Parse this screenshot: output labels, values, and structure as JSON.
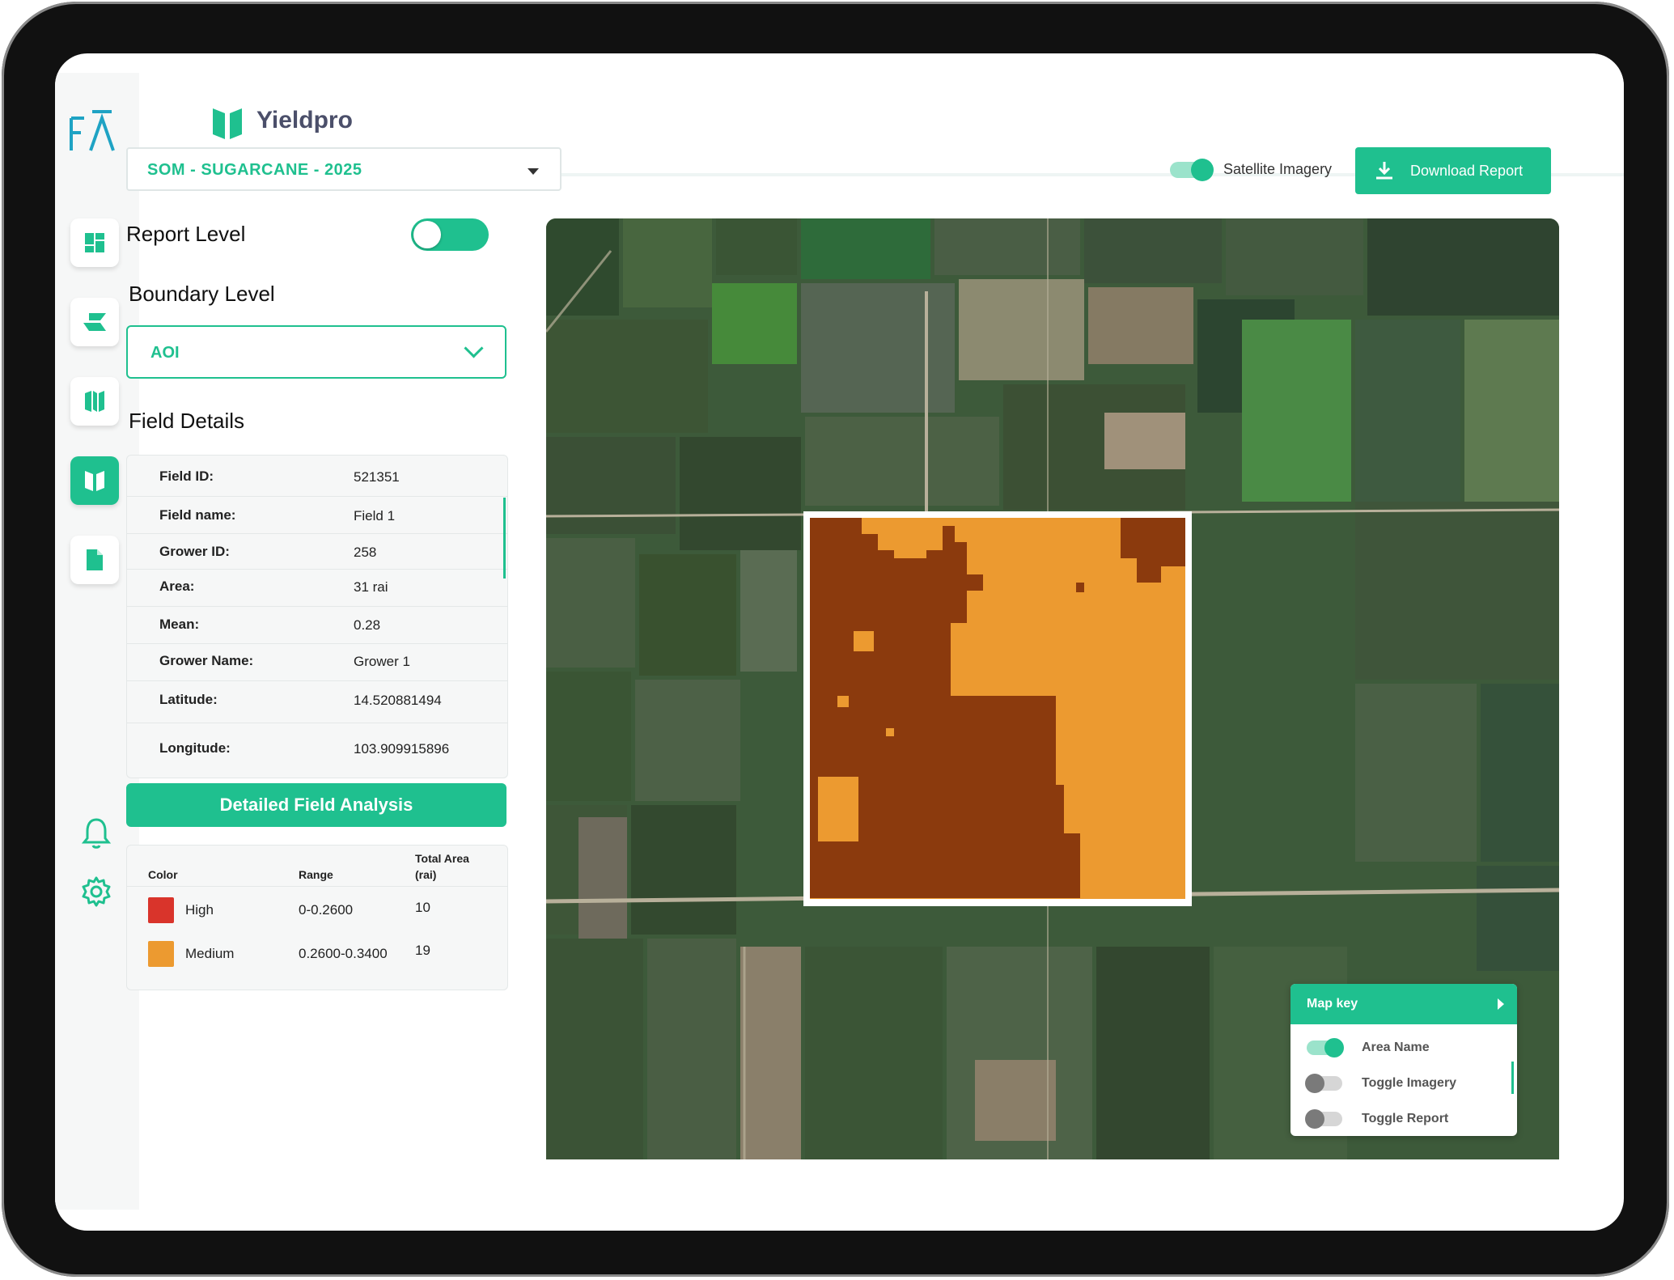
{
  "app": {
    "brand": "Yieldpro",
    "logo_text": "FĀ"
  },
  "sidebar": {
    "items": [
      {
        "name": "dashboard-icon",
        "active": false
      },
      {
        "name": "layers-icon",
        "active": false
      },
      {
        "name": "map-icon",
        "active": false
      },
      {
        "name": "yield-map-icon",
        "active": true
      },
      {
        "name": "document-icon",
        "active": false
      }
    ],
    "bottom": [
      "bell-icon",
      "gear-icon"
    ]
  },
  "season_select": {
    "value": "SOM - SUGARCANE - 2025"
  },
  "report_level": {
    "label": "Report Level",
    "enabled": true
  },
  "boundary_level": {
    "label": "Boundary Level",
    "value": "AOI"
  },
  "field_details": {
    "title": "Field Details",
    "rows": [
      {
        "key": "Field ID:",
        "value": "521351"
      },
      {
        "key": "Field name:",
        "value": "Field 1"
      },
      {
        "key": "Grower ID:",
        "value": "258"
      },
      {
        "key": "Area:",
        "value": "31 rai"
      },
      {
        "key": "Mean:",
        "value": "0.28"
      },
      {
        "key": "Grower Name:",
        "value": "Grower 1"
      },
      {
        "key": "Latitude:",
        "value": "14.520881494"
      },
      {
        "key": "Longitude:",
        "value": "103.909915896"
      }
    ]
  },
  "analysis_button": "Detailed Field Analysis",
  "legend": {
    "headers": {
      "color": "Color",
      "range": "Range",
      "area_line1": "Total Area",
      "area_line2": "(rai)"
    },
    "rows": [
      {
        "label": "High",
        "range": "0-0.2600",
        "area": "10",
        "color": "#d9342b"
      },
      {
        "label": "Medium",
        "range": "0.2600-0.3400",
        "area": "19",
        "color": "#ec9a30"
      }
    ]
  },
  "toolbar": {
    "satellite_label": "Satellite Imagery",
    "satellite_on": true,
    "download_label": "Download Report"
  },
  "map_key": {
    "title": "Map key",
    "items": [
      {
        "label": "Area Name",
        "on": true
      },
      {
        "label": "Toggle Imagery",
        "on": false
      },
      {
        "label": "Toggle Report",
        "on": false
      }
    ]
  },
  "colors": {
    "accent": "#1fc08f",
    "high": "#8b3a0d",
    "medium": "#ec9a30"
  }
}
